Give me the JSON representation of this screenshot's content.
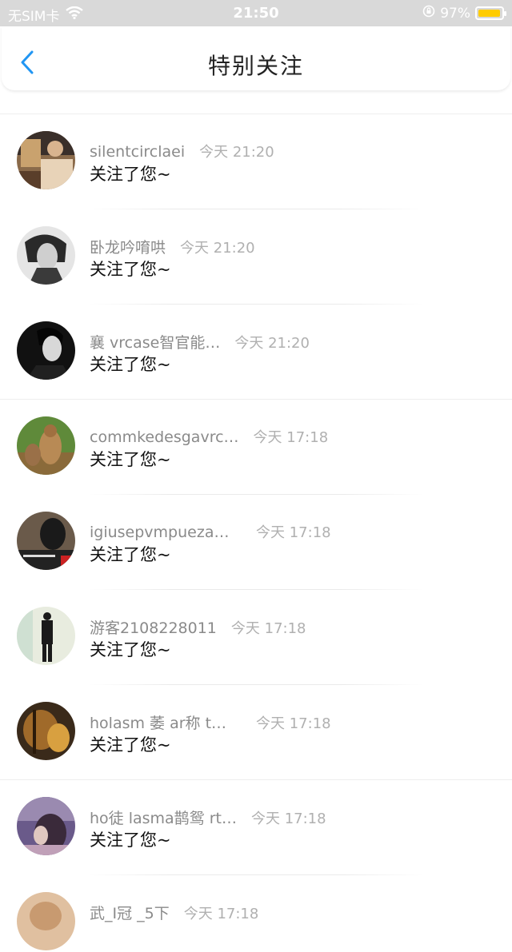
{
  "status": {
    "carrier": "无SIM卡",
    "time": "21:50",
    "battery": "97%",
    "battery_level": 0.97,
    "battery_color": "#ffcc00"
  },
  "nav": {
    "title": "特别关注",
    "back_icon": "chevron-left-icon",
    "accent": "#2196f3"
  },
  "items": [
    {
      "name": "silentcirclaei",
      "time": "今天 21:20",
      "message": "关注了您~"
    },
    {
      "name": "卧龙吟唷哄",
      "time": "今天 21:20",
      "message": "关注了您~"
    },
    {
      "name": "襄 vrcase智官能…",
      "time": "今天 21:20",
      "message": "关注了您~"
    },
    {
      "name": "commkedesgavrc…",
      "time": "今天 17:18",
      "message": "关注了您~"
    },
    {
      "name": "igiusepvmpuezam…",
      "time": "今天 17:18",
      "message": "关注了您~"
    },
    {
      "name": "游客2108228011",
      "time": "今天 17:18",
      "message": "关注了您~"
    },
    {
      "name": "holasm 萎 ar称 t智…",
      "time": "今天 17:18",
      "message": "关注了您~"
    },
    {
      "name": "ho徒 lasma鹊鸳 rt…",
      "time": "今天 17:18",
      "message": "关注了您~"
    },
    {
      "name": "武_I冠 _5下",
      "time": "今天 17:18",
      "message": ""
    }
  ]
}
